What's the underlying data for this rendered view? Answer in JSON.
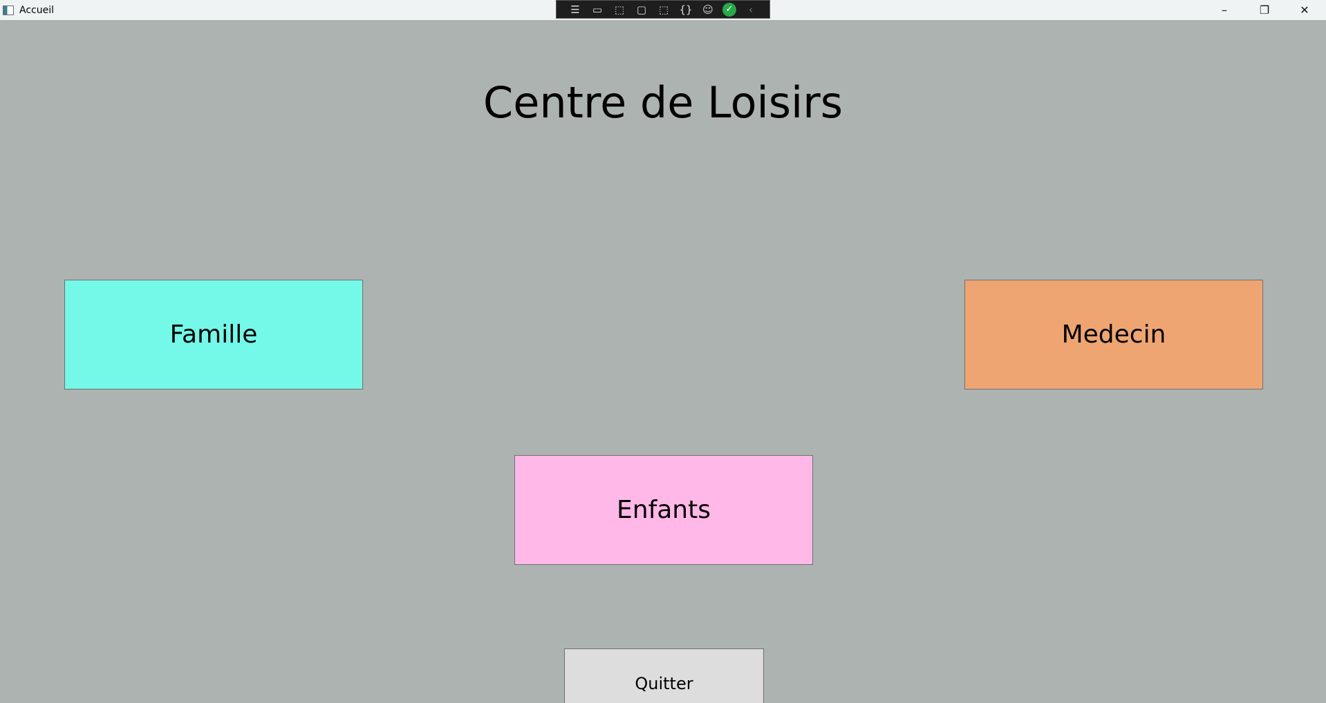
{
  "window": {
    "title": "Accueil",
    "minimize": "–",
    "restore": "❐",
    "close": "✕"
  },
  "devbar": {
    "icons": [
      "live-visual-tree-icon",
      "record-icon",
      "select-element-icon",
      "display-layout-adorners-icon",
      "track-focus-icon",
      "binding-failures-icon",
      "accessibility-icon",
      "check-icon",
      "collapse-icon"
    ]
  },
  "main": {
    "title": "Centre de Loisirs",
    "famille": "Famille",
    "medecin": "Medecin",
    "enfants": "Enfants",
    "quitter": "Quitter"
  },
  "colors": {
    "background": "#adb3b0",
    "famille": "#74f8e8",
    "medecin": "#efa572",
    "enfants": "#ffb8e8",
    "quitter": "#dddddd"
  }
}
